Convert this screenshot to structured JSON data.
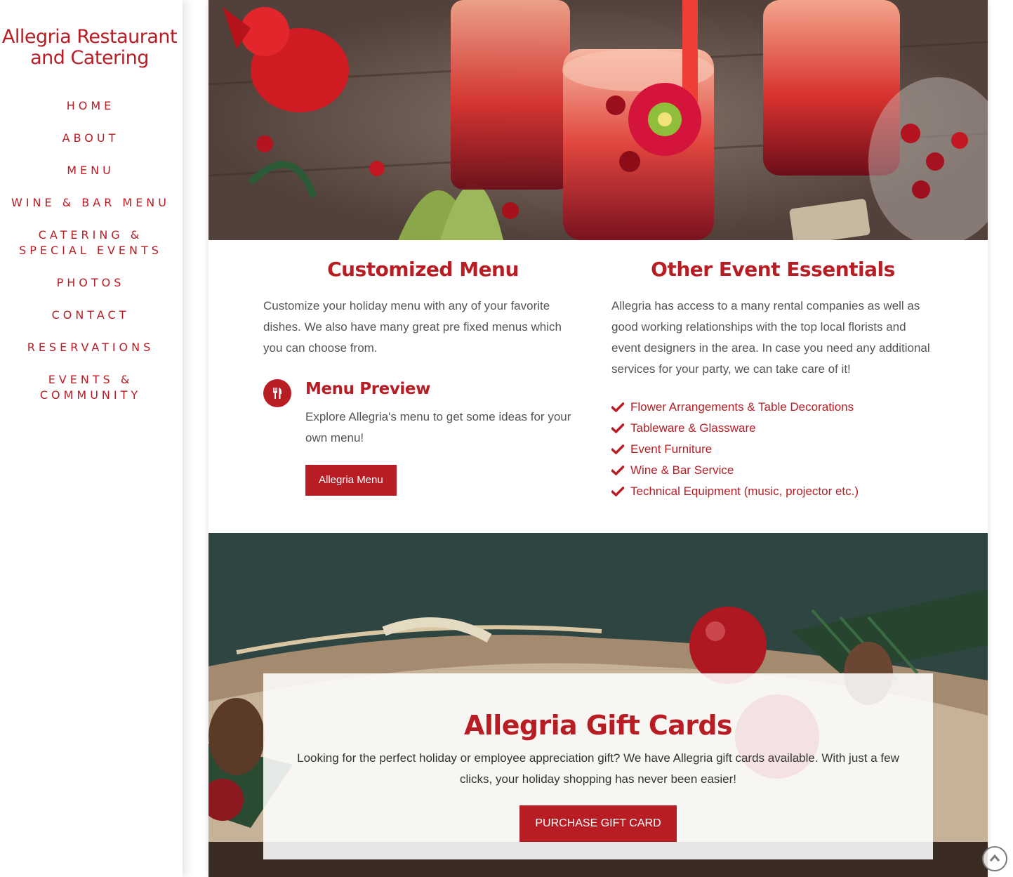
{
  "site": {
    "title_line1": "Allegria Restaurant",
    "title_line2": "and Catering"
  },
  "nav": {
    "items": [
      {
        "label_line1": "HOME"
      },
      {
        "label_line1": "ABOUT"
      },
      {
        "label_line1": "MENU"
      },
      {
        "label_line1": "WINE & BAR MENU"
      },
      {
        "label_line1": "CATERING &",
        "label_line2": "SPECIAL EVENTS"
      },
      {
        "label_line1": "PHOTOS"
      },
      {
        "label_line1": "CONTACT"
      },
      {
        "label_line1": "RESERVATIONS"
      },
      {
        "label_line1": "EVENTS &",
        "label_line2": "COMMUNITY"
      }
    ]
  },
  "customized_menu": {
    "title": "Customized Menu",
    "text": "Customize your holiday menu with any of your favorite dishes. We also have many great pre fixed menus which you can choose from.",
    "feature": {
      "icon": "fork-knife-icon",
      "title": "Menu Preview",
      "text": "Explore Allegria's menu to get some ideas for your own menu!",
      "button_label": "Allegria Menu"
    }
  },
  "event_essentials": {
    "title": "Other Event Essentials",
    "text": "Allegria has access to a many rental companies as well as good working relationships with the top local florists and event designers in the area. In case you need any additional services for your party, we can take care of it!",
    "items": [
      "Flower Arrangements & Table Decorations",
      "Tableware & Glassware",
      "Event Furniture",
      "Wine & Bar Service",
      "Technical Equipment (music, projector etc.)"
    ]
  },
  "gift_cards": {
    "title": "Allegria Gift Cards",
    "text": "Looking for the perfect holiday or employee appreciation gift? We have Allegria gift cards available. With just a few clicks, your holiday shopping has never been easier!",
    "button_label": "PURCHASE GIFT CARD"
  },
  "colors": {
    "brand_red": "#b81d24",
    "text_gray": "#555555"
  }
}
